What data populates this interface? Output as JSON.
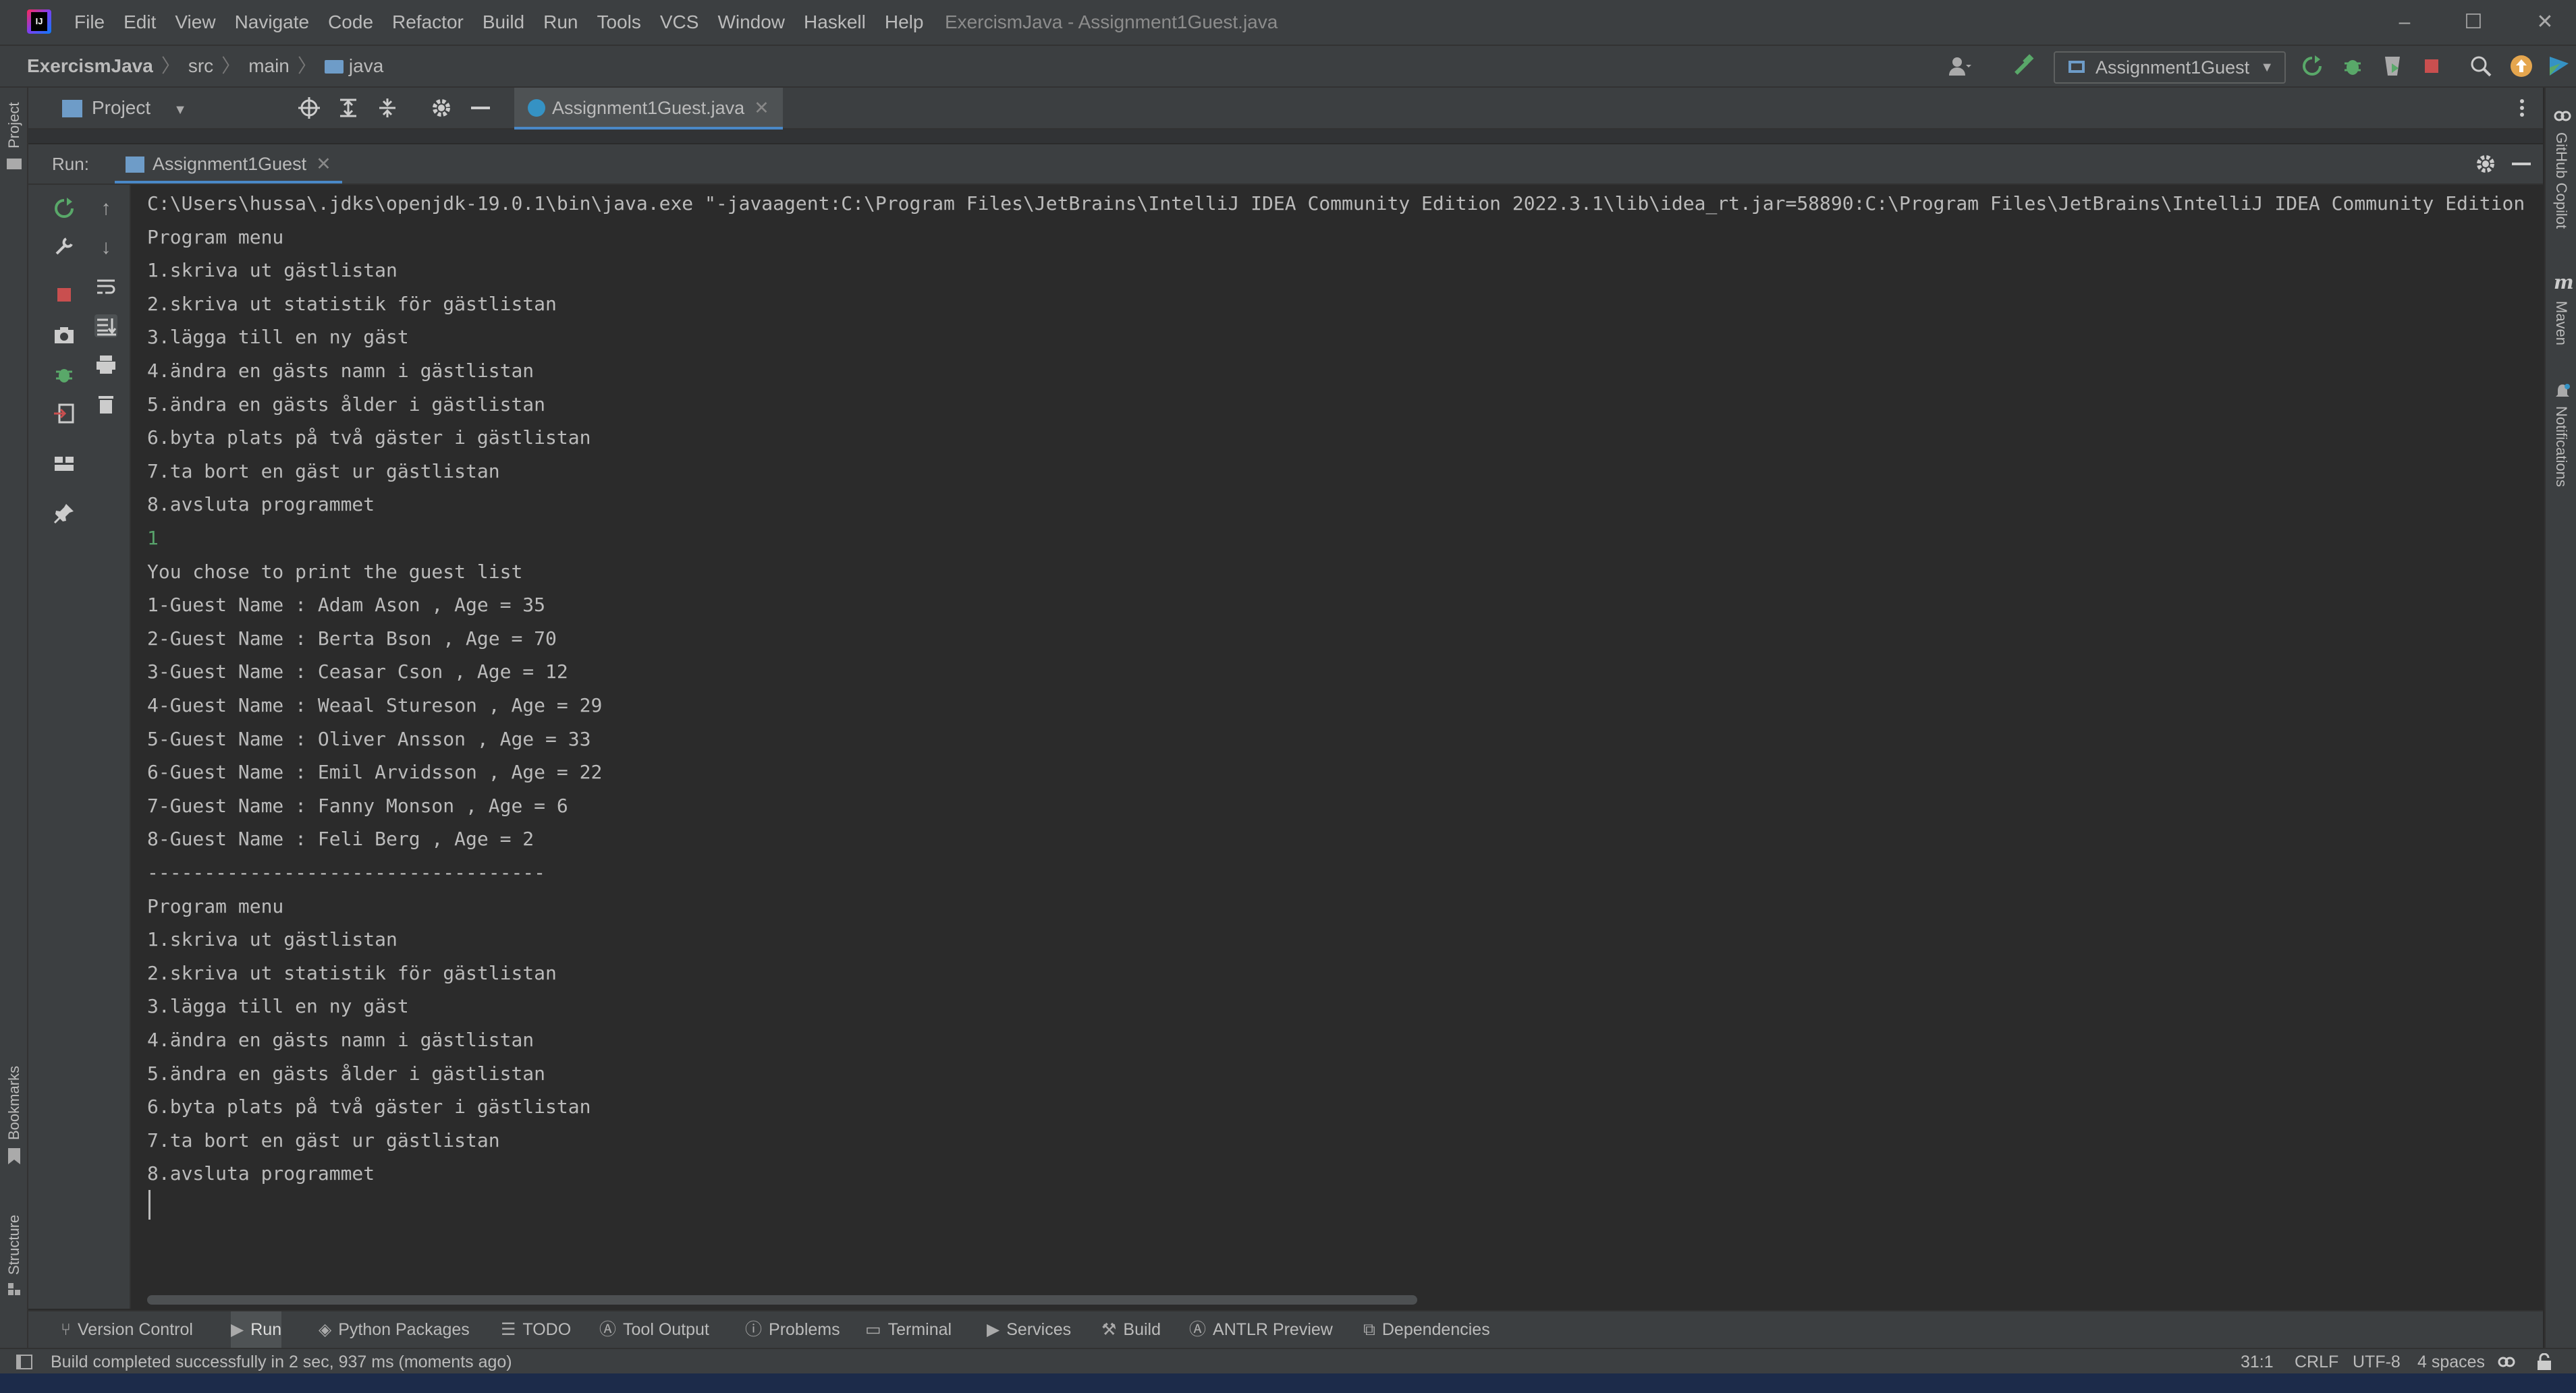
{
  "menu": [
    "File",
    "Edit",
    "View",
    "Navigate",
    "Code",
    "Refactor",
    "Build",
    "Run",
    "Tools",
    "VCS",
    "Window",
    "Haskell",
    "Help"
  ],
  "window_title": "ExercismJava - Assignment1Guest.java",
  "breadcrumb": {
    "project": "ExercismJava",
    "src": "src",
    "main": "main",
    "java": "java"
  },
  "run_config": "Assignment1Guest",
  "project_panel": {
    "label": "Project"
  },
  "editor_tab": "Assignment1Guest.java",
  "run_panel": {
    "label": "Run:",
    "tab": "Assignment1Guest"
  },
  "side_tools": {
    "project": "Project",
    "bookmarks": "Bookmarks",
    "structure": "Structure",
    "copilot": "GitHub Copilot",
    "maven": "Maven",
    "notifications": "Notifications"
  },
  "console": [
    {
      "text": "C:\\Users\\hussa\\.jdks\\openjdk-19.0.1\\bin\\java.exe \"-javaagent:C:\\Program Files\\JetBrains\\IntelliJ IDEA Community Edition 2022.3.1\\lib\\idea_rt.jar=58890:C:\\Program Files\\JetBrains\\IntelliJ IDEA Community Edition",
      "kind": "out"
    },
    {
      "text": "Program menu",
      "kind": "out"
    },
    {
      "text": "1.skriva ut gästlistan",
      "kind": "out"
    },
    {
      "text": "2.skriva ut statistik för gästlistan",
      "kind": "out"
    },
    {
      "text": "3.lägga till en ny gäst",
      "kind": "out"
    },
    {
      "text": "4.ändra en gästs namn i gästlistan",
      "kind": "out"
    },
    {
      "text": "5.ändra en gästs ålder i gästlistan",
      "kind": "out"
    },
    {
      "text": "6.byta plats på två gäster i gästlistan",
      "kind": "out"
    },
    {
      "text": "7.ta bort en gäst ur gästlistan",
      "kind": "out"
    },
    {
      "text": "8.avsluta programmet",
      "kind": "out"
    },
    {
      "text": "1",
      "kind": "input"
    },
    {
      "text": "You chose to print the guest list",
      "kind": "out"
    },
    {
      "text": "1-Guest Name : Adam Ason , Age = 35",
      "kind": "out"
    },
    {
      "text": "2-Guest Name : Berta Bson , Age = 70",
      "kind": "out"
    },
    {
      "text": "3-Guest Name : Ceasar Cson , Age = 12",
      "kind": "out"
    },
    {
      "text": "4-Guest Name : Weaal Stureson , Age = 29",
      "kind": "out"
    },
    {
      "text": "5-Guest Name : Oliver Ansson , Age = 33",
      "kind": "out"
    },
    {
      "text": "6-Guest Name : Emil Arvidsson , Age = 22",
      "kind": "out"
    },
    {
      "text": "7-Guest Name : Fanny Monson , Age = 6",
      "kind": "out"
    },
    {
      "text": "8-Guest Name : Feli Berg , Age = 2",
      "kind": "out"
    },
    {
      "text": "-----------------------------------",
      "kind": "out"
    },
    {
      "text": "Program menu",
      "kind": "out"
    },
    {
      "text": "1.skriva ut gästlistan",
      "kind": "out"
    },
    {
      "text": "2.skriva ut statistik för gästlistan",
      "kind": "out"
    },
    {
      "text": "3.lägga till en ny gäst",
      "kind": "out"
    },
    {
      "text": "4.ändra en gästs namn i gästlistan",
      "kind": "out"
    },
    {
      "text": "5.ändra en gästs ålder i gästlistan",
      "kind": "out"
    },
    {
      "text": "6.byta plats på två gäster i gästlistan",
      "kind": "out"
    },
    {
      "text": "7.ta bort en gäst ur gästlistan",
      "kind": "out"
    },
    {
      "text": "8.avsluta programmet",
      "kind": "out"
    }
  ],
  "bottom_tabs": [
    {
      "label": "Version Control",
      "icon": "branch-icon"
    },
    {
      "label": "Run",
      "icon": "play-icon",
      "active": true
    },
    {
      "label": "Python Packages",
      "icon": "layers-icon"
    },
    {
      "label": "TODO",
      "icon": "list-icon"
    },
    {
      "label": "Tool Output",
      "icon": "output-icon"
    },
    {
      "label": "Problems",
      "icon": "info-icon"
    },
    {
      "label": "Terminal",
      "icon": "terminal-icon"
    },
    {
      "label": "Services",
      "icon": "services-icon"
    },
    {
      "label": "Build",
      "icon": "hammer-icon"
    },
    {
      "label": "ANTLR Preview",
      "icon": "antlr-icon"
    },
    {
      "label": "Dependencies",
      "icon": "stack-icon"
    }
  ],
  "status": {
    "message": "Build completed successfully in 2 sec, 937 ms (moments ago)",
    "position": "31:1",
    "line_sep": "CRLF",
    "encoding": "UTF-8",
    "indent": "4 spaces"
  },
  "colors": {
    "accent": "#4a88c7",
    "input_text": "#58a36b",
    "stop": "#c94f4f",
    "run": "#59a869",
    "warning": "#e5a64e"
  }
}
